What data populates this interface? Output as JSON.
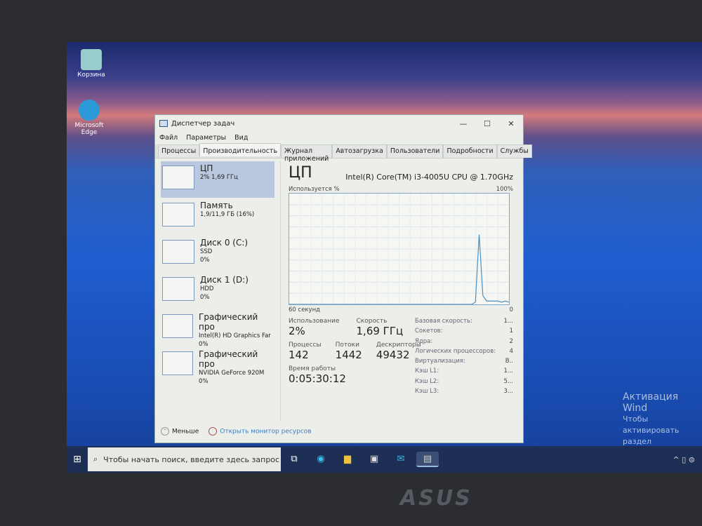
{
  "desktop": {
    "icons": [
      {
        "label": "Корзина"
      },
      {
        "label": "Microsoft Edge"
      }
    ]
  },
  "window": {
    "title": "Диспетчер задач",
    "controls": {
      "minimize": "—",
      "maximize": "☐",
      "close": "✕"
    },
    "menu": [
      "Файл",
      "Параметры",
      "Вид"
    ],
    "tabs": [
      "Процессы",
      "Производительность",
      "Журнал приложений",
      "Автозагрузка",
      "Пользователи",
      "Подробности",
      "Службы"
    ],
    "active_tab": "Производительность",
    "resources": [
      {
        "name": "ЦП",
        "line1": "2% 1,69 ГГц",
        "line2": ""
      },
      {
        "name": "Память",
        "line1": "1,9/11,9 ГБ (16%)",
        "line2": ""
      },
      {
        "name": "Диск 0 (C:)",
        "line1": "SSD",
        "line2": "0%"
      },
      {
        "name": "Диск 1 (D:)",
        "line1": "HDD",
        "line2": "0%"
      },
      {
        "name": "Графический про",
        "line1": "Intel(R) HD Graphics Far",
        "line2": "0%"
      },
      {
        "name": "Графический про",
        "line1": "NVIDIA GeForce 920M",
        "line2": "0%"
      }
    ],
    "detail": {
      "title": "ЦП",
      "model": "Intel(R) Core(TM) i3-4005U CPU @ 1.70GHz",
      "graph_label": "Используется %",
      "graph_max": "100%",
      "graph_time": "60 секунд",
      "graph_min": "0",
      "usage_label": "Использование",
      "usage": "2%",
      "speed_label": "Скорость",
      "speed": "1,69 ГГц",
      "proc_label": "Процессы",
      "proc": "142",
      "threads_label": "Потоки",
      "threads": "1442",
      "handles_label": "Дескрипторы",
      "handles": "49432",
      "uptime_label": "Время работы",
      "uptime": "0:05:30:12",
      "specs": [
        [
          "Базовая скорость:",
          "1..."
        ],
        [
          "Сокетов:",
          "1"
        ],
        [
          "Ядра:",
          "2"
        ],
        [
          "Логических процессоров:",
          "4"
        ],
        [
          "Виртуализация:",
          "В.."
        ],
        [
          "Кэш L1:",
          "1..."
        ],
        [
          "Кэш L2:",
          "5..."
        ],
        [
          "Кэш L3:",
          "3..."
        ]
      ]
    },
    "footer": {
      "less": "Меньше",
      "monitor": "Открыть монитор ресурсов"
    }
  },
  "chart_data": {
    "type": "line",
    "xlabel": "60 секунд",
    "ylabel": "Используется %",
    "ylim": [
      0,
      100
    ],
    "xlim": [
      60,
      0
    ],
    "values": [
      0,
      0,
      0,
      0,
      0,
      0,
      0,
      0,
      0,
      0,
      0,
      0,
      0,
      0,
      0,
      0,
      0,
      0,
      0,
      0,
      0,
      0,
      0,
      0,
      0,
      0,
      0,
      0,
      0,
      0,
      0,
      0,
      0,
      0,
      0,
      0,
      0,
      0,
      0,
      0,
      0,
      0,
      0,
      0,
      0,
      0,
      0,
      0,
      0,
      0,
      2,
      63,
      8,
      3,
      3,
      3,
      3,
      2,
      3,
      2
    ]
  },
  "taskbar": {
    "search_placeholder": "Чтобы начать поиск, введите здесь запрос"
  },
  "activation": {
    "title": "Активация Wind",
    "line1": "Чтобы активировать",
    "line2": "раздел \"Параметры\"."
  },
  "brand": "ASUS",
  "colors": {
    "graph_line": "#4a8fc0",
    "selected": "#b9c8de",
    "taskbar": "#1d2f55"
  }
}
